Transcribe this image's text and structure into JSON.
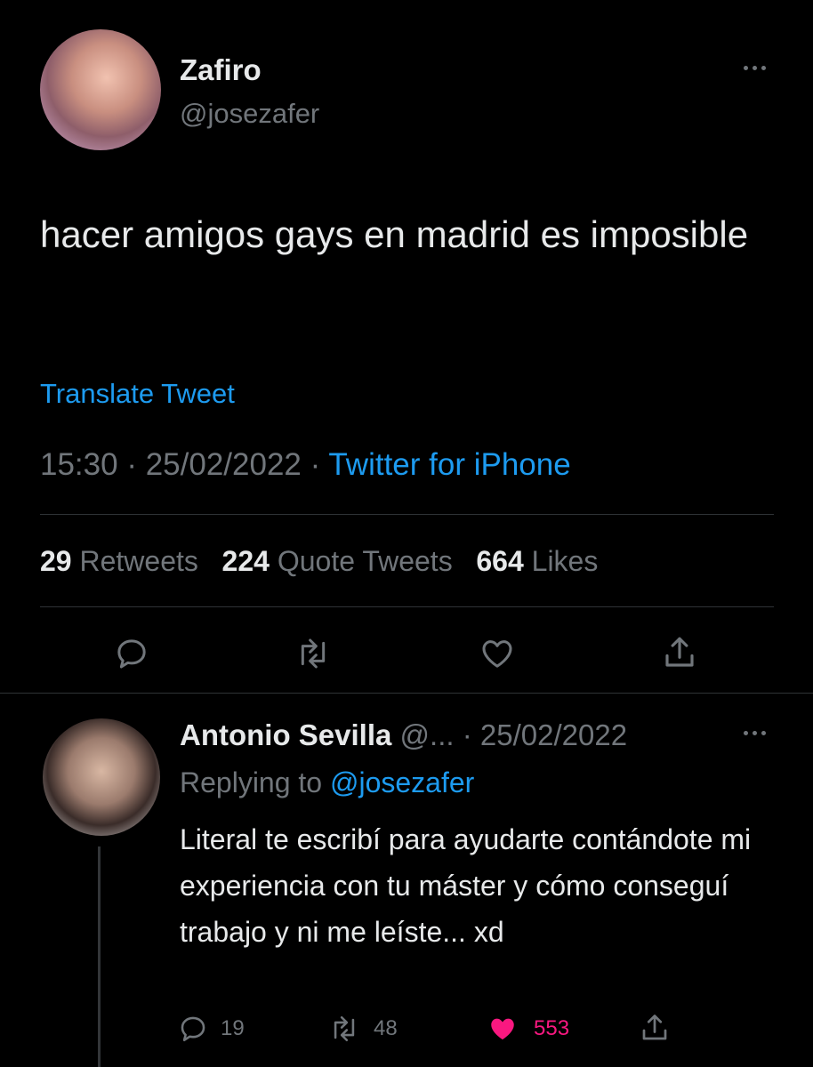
{
  "tweet": {
    "author_name": "Zafiro",
    "author_handle": "@josezafer",
    "text": "hacer amigos gays en madrid es imposible",
    "translate_label": "Translate Tweet",
    "time": "15:30",
    "date": "25/02/2022",
    "source": "Twitter for iPhone",
    "retweets_count": "29",
    "retweets_label": "Retweets",
    "quotes_count": "224",
    "quotes_label": "Quote Tweets",
    "likes_count": "664",
    "likes_label": "Likes"
  },
  "reply": {
    "author_name": "Antonio Sevilla",
    "author_handle_truncated": "@...",
    "date": "25/02/2022",
    "replying_prefix": "Replying to",
    "replying_handle": "@josezafer",
    "text": "Literal te escribí para ayudarte contándote mi experiencia con tu máster y cómo conseguí trabajo y ni me leíste... xd",
    "reply_count": "19",
    "retweet_count": "48",
    "like_count": "553"
  },
  "colors": {
    "background": "#000000",
    "text_primary": "#e7e9ea",
    "text_muted": "#71767b",
    "link": "#1d9bf0",
    "like_active": "#f91880",
    "divider": "#2f3336"
  },
  "icons": [
    "more-icon",
    "reply-icon",
    "retweet-icon",
    "like-icon",
    "share-icon"
  ]
}
